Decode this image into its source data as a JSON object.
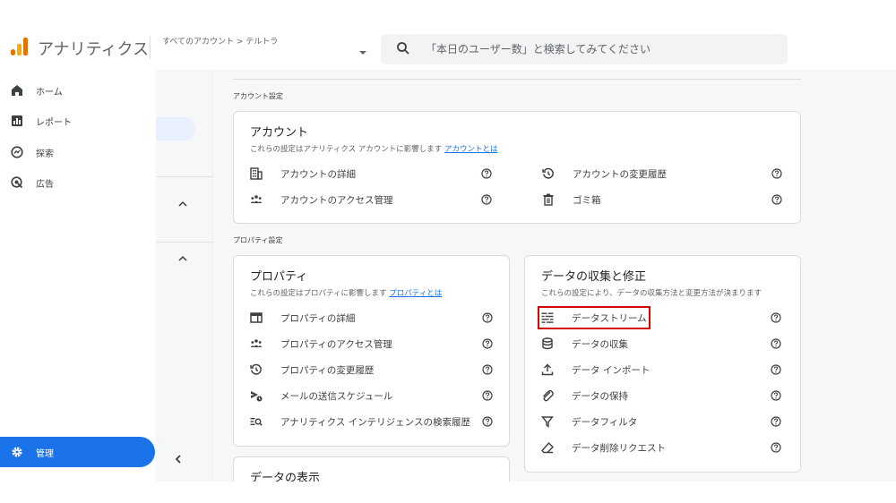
{
  "header": {
    "app_title": "アナリティクス",
    "breadcrumb": "すべてのアカウント > テルトラ",
    "search_placeholder": "「本日のユーザー数」と検索してみてください"
  },
  "nav": {
    "items": [
      {
        "label": "ホーム",
        "icon": "home-icon"
      },
      {
        "label": "レポート",
        "icon": "reports-icon"
      },
      {
        "label": "探索",
        "icon": "explore-icon"
      },
      {
        "label": "広告",
        "icon": "advertising-icon"
      }
    ],
    "admin_label": "管理"
  },
  "account_section": {
    "label": "アカウント設定",
    "card": {
      "title": "アカウント",
      "desc": "これらの設定はアナリティクス アカウントに影響します",
      "link": "アカウントとは",
      "left_rows": [
        {
          "label": "アカウントの詳細",
          "icon": "building-icon"
        },
        {
          "label": "アカウントのアクセス管理",
          "icon": "people-icon"
        }
      ],
      "right_rows": [
        {
          "label": "アカウントの変更履歴",
          "icon": "history-icon"
        },
        {
          "label": "ゴミ箱",
          "icon": "trash-icon"
        }
      ]
    }
  },
  "property_section": {
    "label": "プロパティ設定",
    "property_card": {
      "title": "プロパティ",
      "desc": "これらの設定はプロパティに影響します",
      "link": "プロパティとは",
      "rows": [
        {
          "label": "プロパティの詳細",
          "icon": "property-details-icon"
        },
        {
          "label": "プロパティのアクセス管理",
          "icon": "people-icon"
        },
        {
          "label": "プロパティの変更履歴",
          "icon": "history-icon"
        },
        {
          "label": "メールの送信スケジュール",
          "icon": "scheduled-email-icon"
        },
        {
          "label": "アナリティクス インテリジェンスの検索履歴",
          "icon": "search-history-icon"
        }
      ]
    },
    "data_card": {
      "title": "データの収集と修正",
      "desc": "これらの設定により、データの収集方法と変更方法が決まります",
      "rows": [
        {
          "label": "データストリーム",
          "icon": "data-streams-icon"
        },
        {
          "label": "データの収集",
          "icon": "database-icon"
        },
        {
          "label": "データ インポート",
          "icon": "upload-icon"
        },
        {
          "label": "データの保持",
          "icon": "retention-icon"
        },
        {
          "label": "データフィルタ",
          "icon": "filter-icon"
        },
        {
          "label": "データ削除リクエスト",
          "icon": "eraser-icon"
        }
      ]
    },
    "display_card": {
      "title": "データの表示"
    }
  },
  "colors": {
    "accent": "#1a73e8",
    "highlight": "#d50000",
    "logo_orange": "#e37400",
    "logo_yellow": "#f9ab00"
  }
}
